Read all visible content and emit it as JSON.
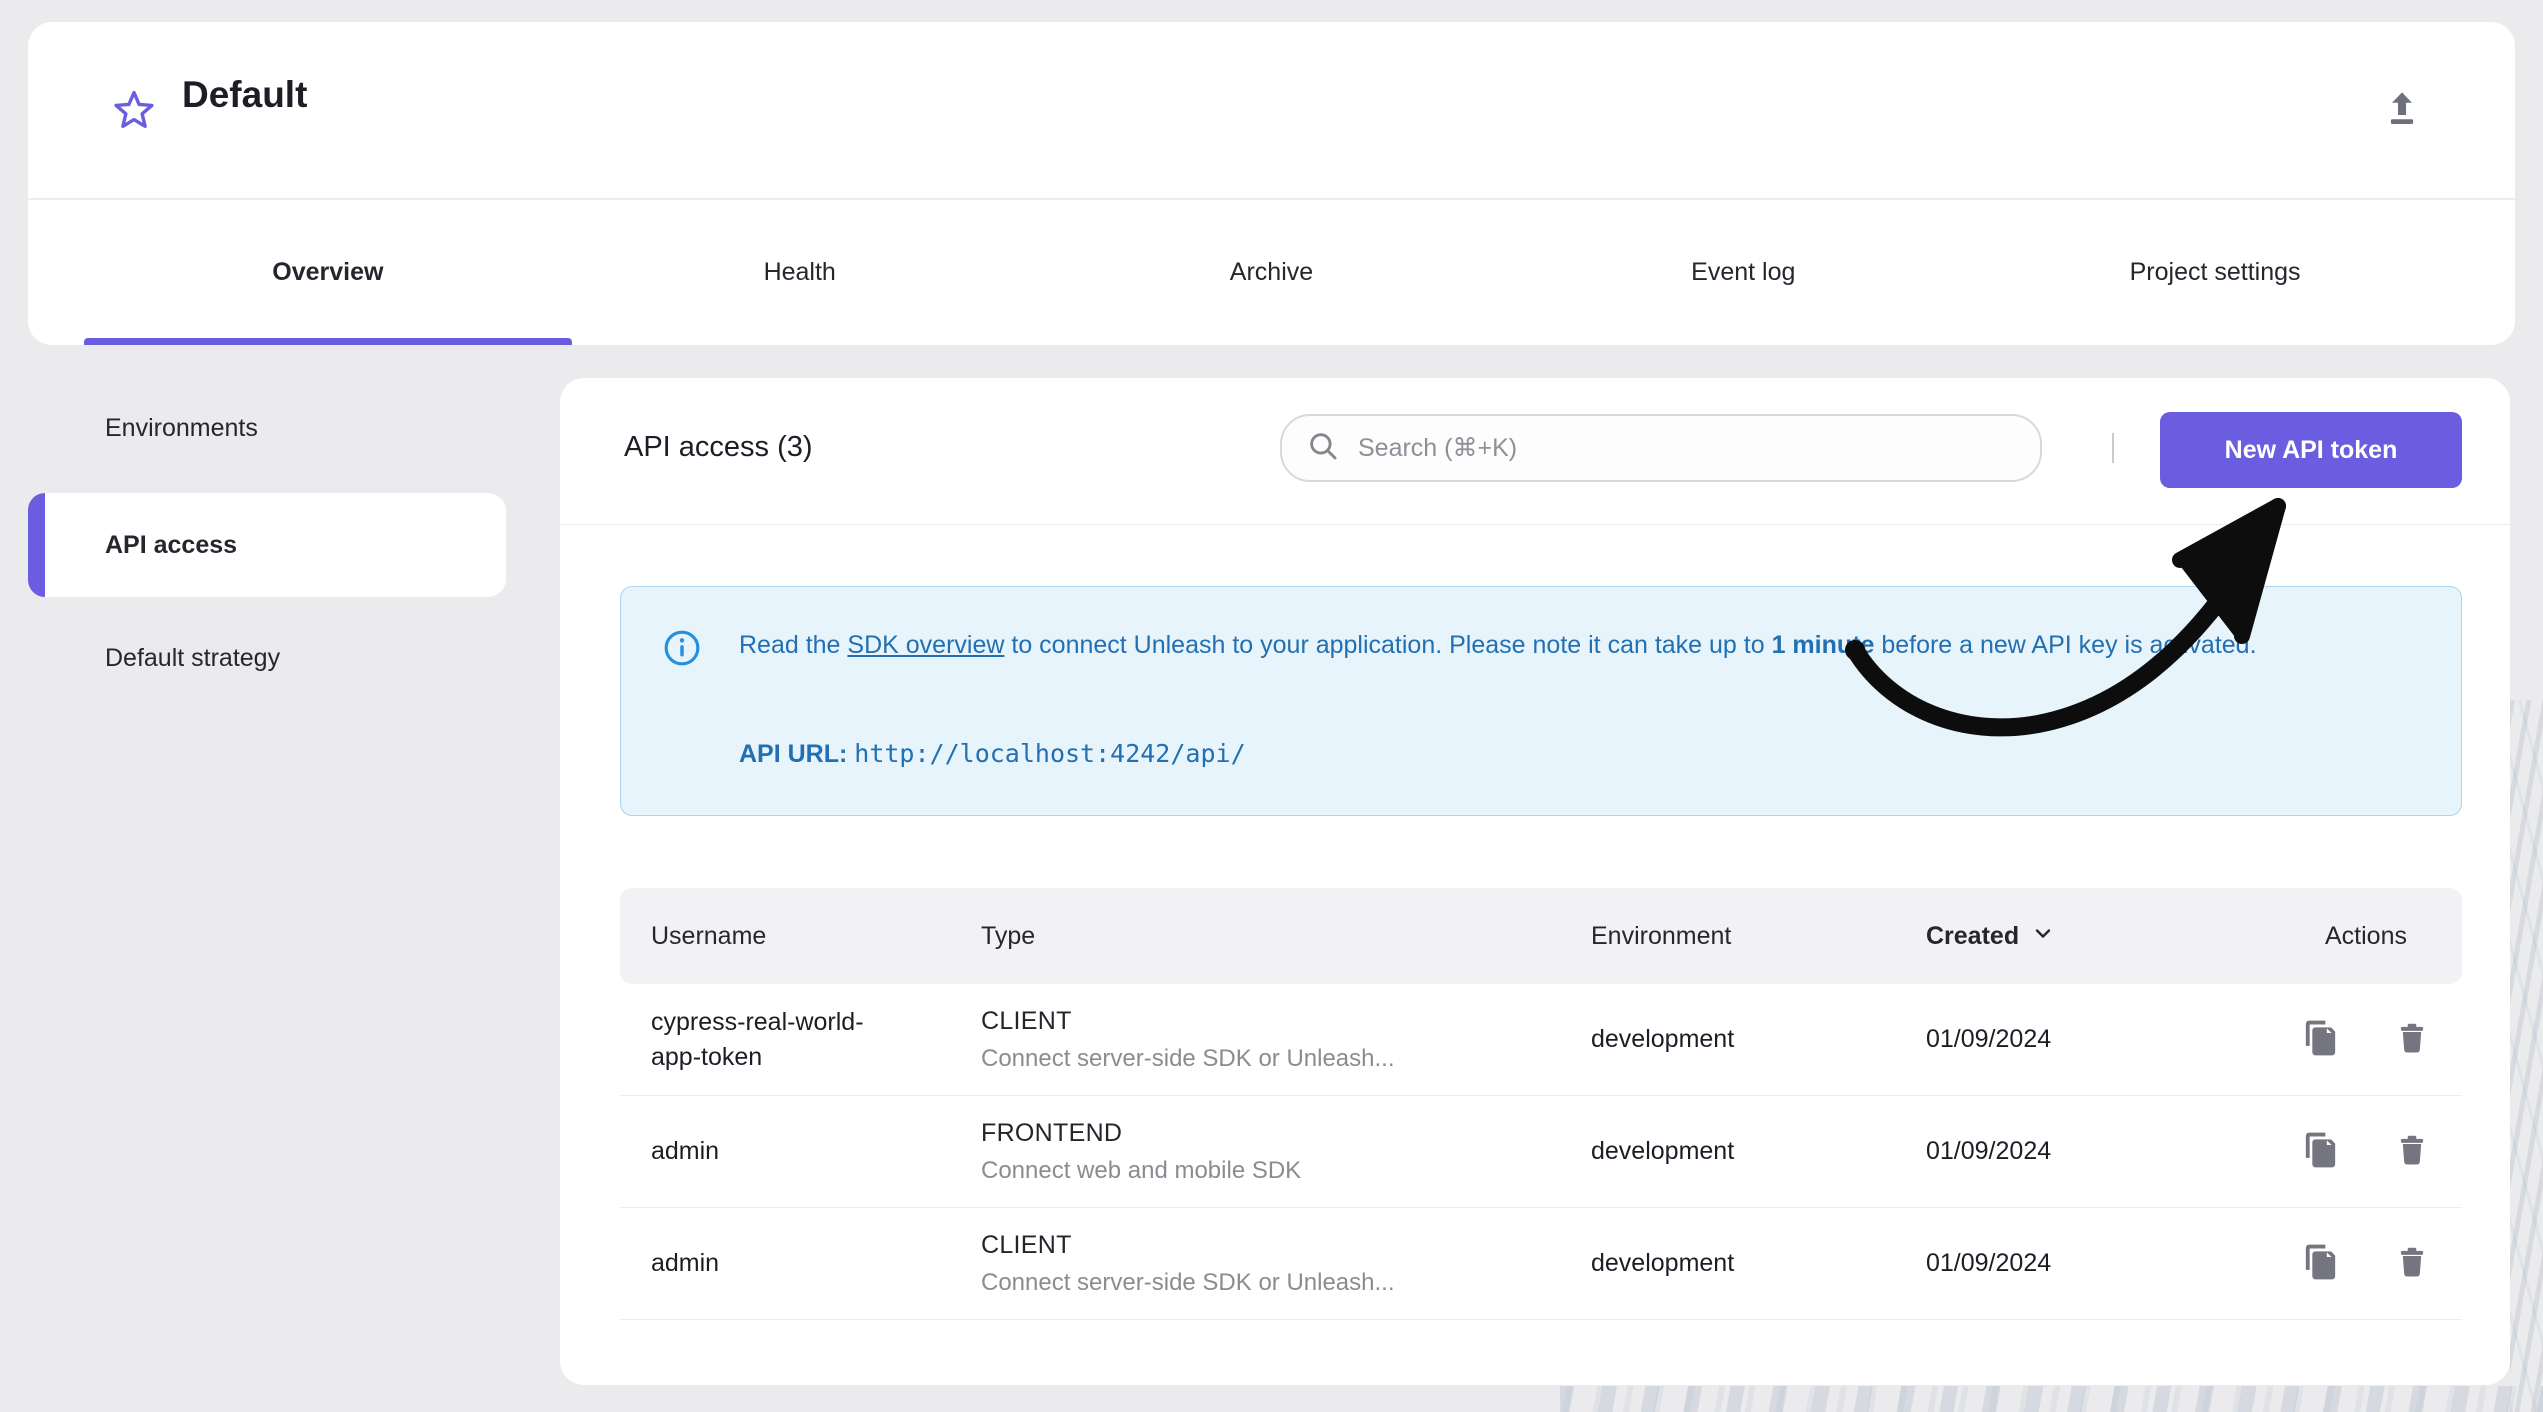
{
  "colors": {
    "accent": "#6b5de0",
    "alert_background": "#e7f4fb",
    "alert_border": "#abd4ee",
    "alert_text": "#2270b2",
    "table_header_background": "#f2f2f4",
    "icon_gray": "#75757f",
    "page_background": "#ebebed"
  },
  "header": {
    "title": "Default",
    "favorite_icon": "star-outline-icon",
    "upload_icon": "file-upload-icon",
    "tabs": [
      {
        "label": "Overview",
        "active": true
      },
      {
        "label": "Health",
        "active": false
      },
      {
        "label": "Archive",
        "active": false
      },
      {
        "label": "Event log",
        "active": false
      },
      {
        "label": "Project settings",
        "active": false
      }
    ]
  },
  "sidebar": {
    "items": [
      {
        "label": "Environments",
        "active": false
      },
      {
        "label": "API access",
        "active": true
      },
      {
        "label": "Default strategy",
        "active": false
      }
    ]
  },
  "main": {
    "heading": "API access (3)",
    "search": {
      "placeholder": "Search (⌘+K)",
      "icon": "search-icon"
    },
    "new_token_button": {
      "label": "New API token"
    },
    "alert": {
      "icon": "info-icon",
      "text_start": "Read the ",
      "link_text": "SDK overview",
      "text_middle": " to connect Unleash to your application. Please note it can take up to ",
      "bold_text": "1 minute",
      "text_end": " before a new API key is activated.",
      "api_url_label": "API URL",
      "api_url_separator": ": ",
      "api_url_value": "http://localhost:4242/api/"
    },
    "table": {
      "columns": {
        "username": "Username",
        "type": "Type",
        "environment": "Environment",
        "created": "Created",
        "actions": "Actions"
      },
      "sort": {
        "column": "Created",
        "direction": "descending"
      },
      "row_action_icons": [
        "copy-icon",
        "delete-icon"
      ],
      "rows": [
        {
          "username": "cypress-real-world-app-token",
          "type": "CLIENT",
          "type_description": "Connect server-side SDK or Unleash...",
          "environment": "development",
          "created": "01/09/2024"
        },
        {
          "username": "admin",
          "type": "FRONTEND",
          "type_description": "Connect web and mobile SDK",
          "environment": "development",
          "created": "01/09/2024"
        },
        {
          "username": "admin",
          "type": "CLIENT",
          "type_description": "Connect server-side SDK or Unleash...",
          "environment": "development",
          "created": "01/09/2024"
        }
      ]
    }
  },
  "annotation": {
    "shape": "hand-drawn-arrow",
    "color": "#0d0d0d",
    "points_to": "New API token"
  }
}
